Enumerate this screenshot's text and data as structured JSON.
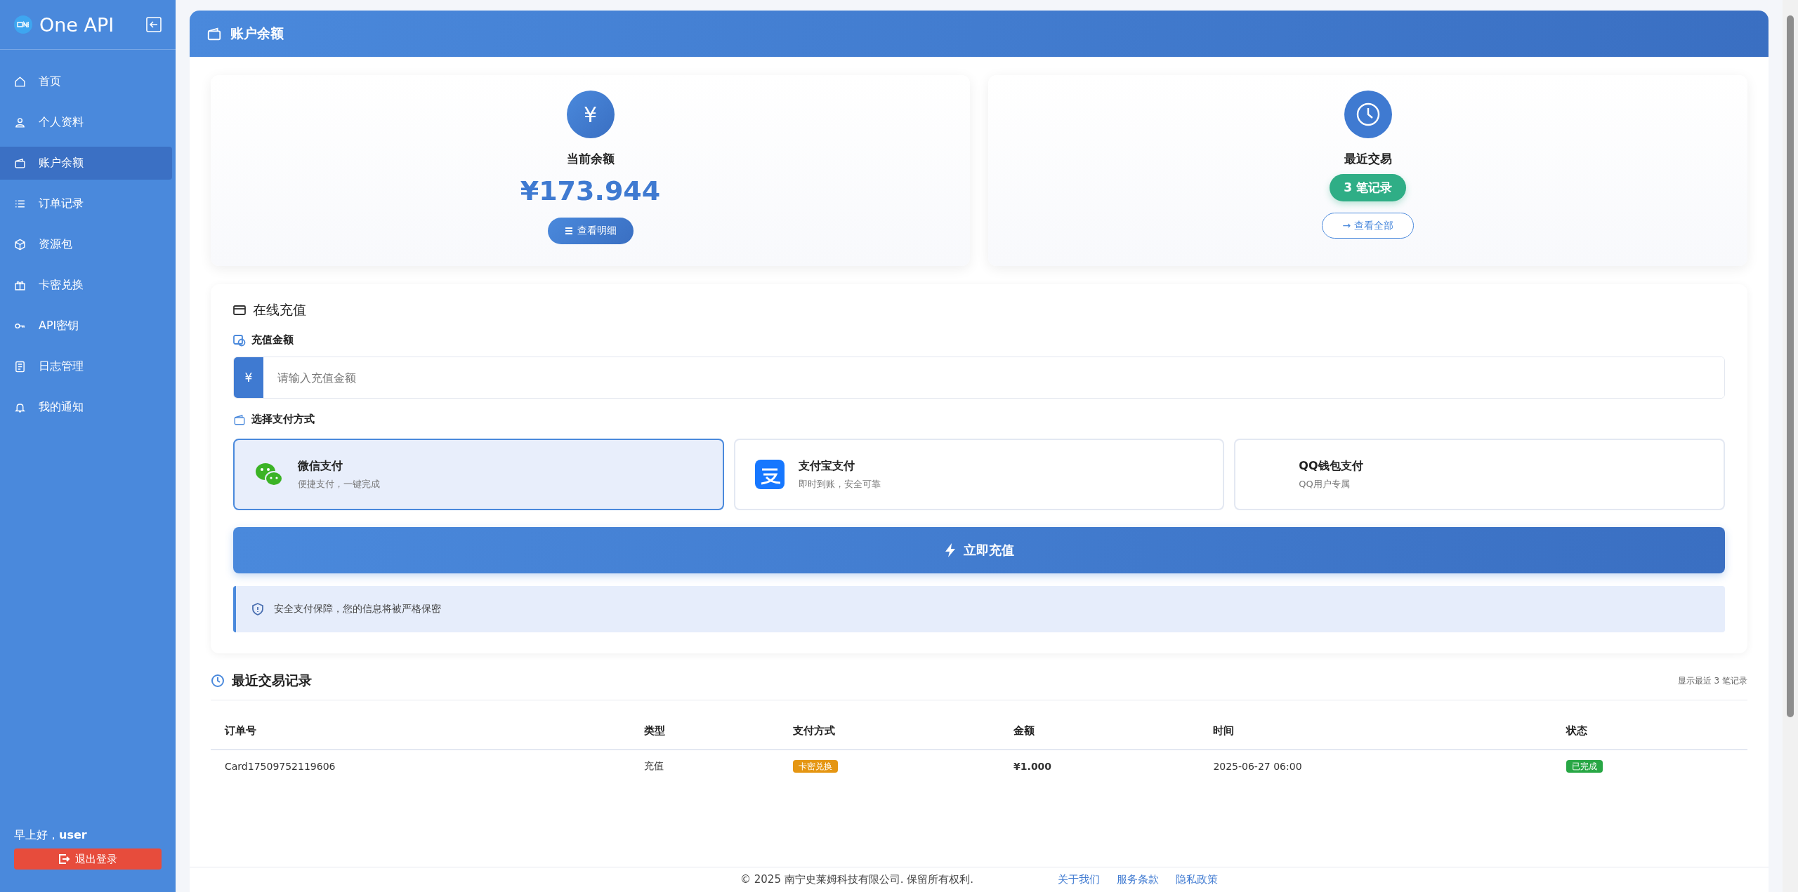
{
  "sidebar": {
    "logo_text": "One API",
    "items": [
      {
        "label": "首页",
        "selected": false
      },
      {
        "label": "个人资料",
        "selected": false
      },
      {
        "label": "账户余额",
        "selected": true
      },
      {
        "label": "订单记录",
        "selected": false
      },
      {
        "label": "资源包",
        "selected": false
      },
      {
        "label": "卡密兑换",
        "selected": false
      },
      {
        "label": "API密钥",
        "selected": false
      },
      {
        "label": "日志管理",
        "selected": false
      },
      {
        "label": "我的通知",
        "selected": false
      }
    ],
    "greeting": "早上好，",
    "username": "user",
    "logout": "退出登录"
  },
  "header": {
    "title": "账户余额"
  },
  "balance_card": {
    "icon_symbol": "¥",
    "title": "当前余额",
    "amount": "¥173.944",
    "button": "查看明细"
  },
  "recent_card": {
    "title": "最近交易",
    "count_badge": "3 笔记录",
    "button": "→ 查看全部"
  },
  "recharge": {
    "title": "在线充值",
    "amount_label": "充值金额",
    "currency": "¥",
    "placeholder": "请输入充值金额",
    "method_label": "选择支付方式",
    "methods": [
      {
        "kind": "wechat",
        "name": "微信支付",
        "desc": "便捷支付，一键完成",
        "selected": true
      },
      {
        "kind": "alipay",
        "name": "支付宝支付",
        "desc": "即时到账，安全可靠",
        "selected": false
      },
      {
        "kind": "qq",
        "name": "QQ钱包支付",
        "desc": "QQ用户专属",
        "selected": false
      }
    ],
    "submit": "立即充值",
    "notice": "安全支付保障，您的信息将被严格保密"
  },
  "transactions": {
    "title": "最近交易记录",
    "summary": "显示最近 3 笔记录",
    "columns": [
      "订单号",
      "类型",
      "支付方式",
      "金额",
      "时间",
      "状态"
    ],
    "rows": [
      {
        "order": "Card17509752119606",
        "type": "充值",
        "method": "卡密兑换",
        "amount": "¥1.000",
        "time": "2025-06-27 06:00",
        "status": "已完成"
      }
    ]
  },
  "footer": {
    "copyright": "© 2025 南宁史莱姆科技有限公司. 保留所有权利.",
    "links": [
      "关于我们",
      "服务条款",
      "隐私政策"
    ]
  }
}
